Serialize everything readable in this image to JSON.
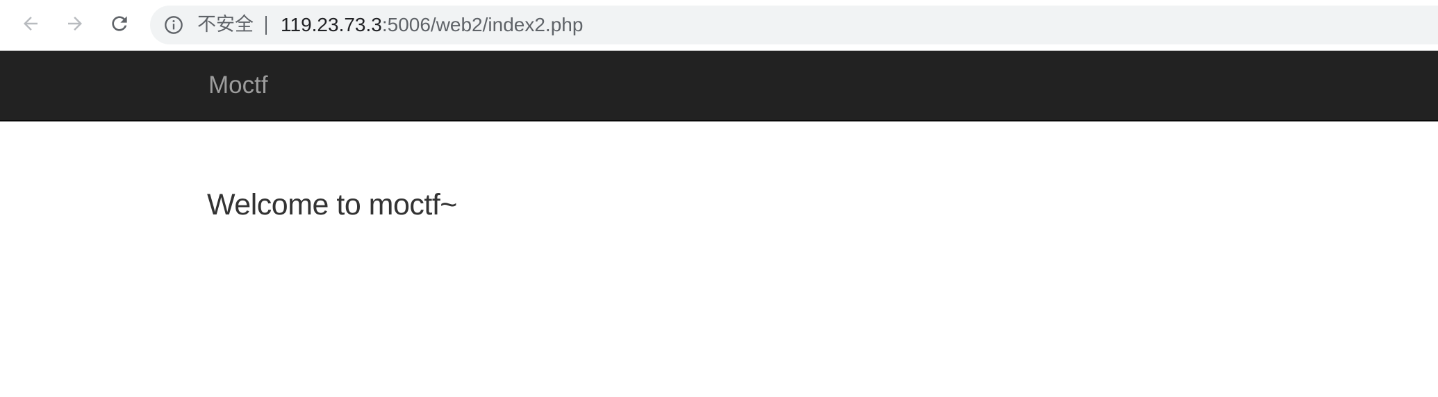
{
  "browser": {
    "security_label": "不安全",
    "url_host": "119.23.73.3",
    "url_rest": ":5006/web2/index2.php",
    "icons": {
      "back": "arrow-left-icon",
      "forward": "arrow-right-icon",
      "reload": "reload-icon",
      "info": "info-icon"
    }
  },
  "site": {
    "brand": "Moctf",
    "navbar_color": "#222222",
    "brand_color": "#9d9d9d"
  },
  "main": {
    "welcome": "Welcome to moctf~"
  }
}
